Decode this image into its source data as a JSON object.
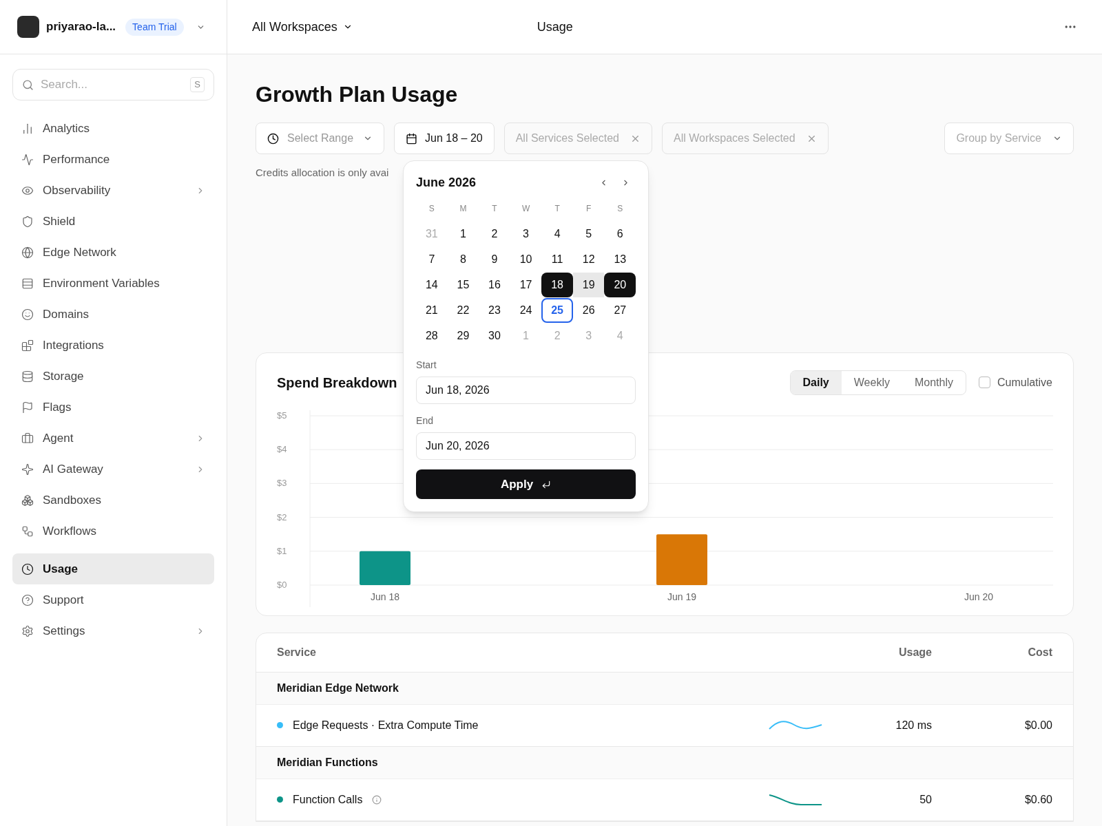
{
  "account": {
    "name": "priyarao-la...",
    "badge": "Team Trial"
  },
  "header": {
    "workspace": "All Workspaces",
    "title": "Usage"
  },
  "sidebar": {
    "search": {
      "placeholder": "Search...",
      "shortcut": "S"
    },
    "items": [
      {
        "label": "Analytics",
        "expandable": false,
        "selected": false
      },
      {
        "label": "Performance",
        "expandable": false,
        "selected": false
      },
      {
        "label": "Observability",
        "expandable": true,
        "selected": false
      },
      {
        "label": "Shield",
        "expandable": false,
        "selected": false
      },
      {
        "label": "Edge Network",
        "expandable": false,
        "selected": false
      },
      {
        "label": "Environment Variables",
        "expandable": false,
        "selected": false
      },
      {
        "label": "Domains",
        "expandable": false,
        "selected": false
      },
      {
        "label": "Integrations",
        "expandable": false,
        "selected": false
      },
      {
        "label": "Storage",
        "expandable": false,
        "selected": false
      },
      {
        "label": "Flags",
        "expandable": false,
        "selected": false
      },
      {
        "label": "Agent",
        "expandable": true,
        "selected": false
      },
      {
        "label": "AI Gateway",
        "expandable": true,
        "selected": false
      },
      {
        "label": "Sandboxes",
        "expandable": false,
        "selected": false
      },
      {
        "label": "Workflows",
        "expandable": false,
        "selected": false
      },
      {
        "label": "Usage",
        "expandable": false,
        "selected": true
      },
      {
        "label": "Support",
        "expandable": false,
        "selected": false
      },
      {
        "label": "Settings",
        "expandable": true,
        "selected": false
      }
    ]
  },
  "page": {
    "title": "Growth Plan Usage",
    "filters": {
      "range": "Select Range",
      "dates": "Jun 18 – 20",
      "services": "All Services Selected",
      "workspaces": "All Workspaces Selected",
      "group": "Group by Service"
    },
    "note": "Credits allocation is only avai"
  },
  "calendar": {
    "month": "June 2026",
    "weekdays": [
      "S",
      "M",
      "T",
      "W",
      "T",
      "F",
      "S"
    ],
    "days": [
      {
        "label": "31",
        "outside": true,
        "selected": false,
        "in_range": false,
        "today": false
      },
      {
        "label": "1",
        "outside": false,
        "selected": false,
        "in_range": false,
        "today": false
      },
      {
        "label": "2",
        "outside": false,
        "selected": false,
        "in_range": false,
        "today": false
      },
      {
        "label": "3",
        "outside": false,
        "selected": false,
        "in_range": false,
        "today": false
      },
      {
        "label": "4",
        "outside": false,
        "selected": false,
        "in_range": false,
        "today": false
      },
      {
        "label": "5",
        "outside": false,
        "selected": false,
        "in_range": false,
        "today": false
      },
      {
        "label": "6",
        "outside": false,
        "selected": false,
        "in_range": false,
        "today": false
      },
      {
        "label": "7",
        "outside": false,
        "selected": false,
        "in_range": false,
        "today": false
      },
      {
        "label": "8",
        "outside": false,
        "selected": false,
        "in_range": false,
        "today": false
      },
      {
        "label": "9",
        "outside": false,
        "selected": false,
        "in_range": false,
        "today": false
      },
      {
        "label": "10",
        "outside": false,
        "selected": false,
        "in_range": false,
        "today": false
      },
      {
        "label": "11",
        "outside": false,
        "selected": false,
        "in_range": false,
        "today": false
      },
      {
        "label": "12",
        "outside": false,
        "selected": false,
        "in_range": false,
        "today": false
      },
      {
        "label": "13",
        "outside": false,
        "selected": false,
        "in_range": false,
        "today": false
      },
      {
        "label": "14",
        "outside": false,
        "selected": false,
        "in_range": false,
        "today": false
      },
      {
        "label": "15",
        "outside": false,
        "selected": false,
        "in_range": false,
        "today": false
      },
      {
        "label": "16",
        "outside": false,
        "selected": false,
        "in_range": false,
        "today": false
      },
      {
        "label": "17",
        "outside": false,
        "selected": false,
        "in_range": false,
        "today": false
      },
      {
        "label": "18",
        "outside": false,
        "selected": true,
        "in_range": true,
        "today": false
      },
      {
        "label": "19",
        "outside": false,
        "selected": false,
        "in_range": true,
        "today": false
      },
      {
        "label": "20",
        "outside": false,
        "selected": true,
        "in_range": true,
        "today": false
      },
      {
        "label": "21",
        "outside": false,
        "selected": false,
        "in_range": false,
        "today": false
      },
      {
        "label": "22",
        "outside": false,
        "selected": false,
        "in_range": false,
        "today": false
      },
      {
        "label": "23",
        "outside": false,
        "selected": false,
        "in_range": false,
        "today": false
      },
      {
        "label": "24",
        "outside": false,
        "selected": false,
        "in_range": false,
        "today": false
      },
      {
        "label": "25",
        "outside": false,
        "selected": false,
        "in_range": false,
        "today": true
      },
      {
        "label": "26",
        "outside": false,
        "selected": false,
        "in_range": false,
        "today": false
      },
      {
        "label": "27",
        "outside": false,
        "selected": false,
        "in_range": false,
        "today": false
      },
      {
        "label": "28",
        "outside": false,
        "selected": false,
        "in_range": false,
        "today": false
      },
      {
        "label": "29",
        "outside": false,
        "selected": false,
        "in_range": false,
        "today": false
      },
      {
        "label": "30",
        "outside": false,
        "selected": false,
        "in_range": false,
        "today": false
      },
      {
        "label": "1",
        "outside": true,
        "selected": false,
        "in_range": false,
        "today": false
      },
      {
        "label": "2",
        "outside": true,
        "selected": false,
        "in_range": false,
        "today": false
      },
      {
        "label": "3",
        "outside": true,
        "selected": false,
        "in_range": false,
        "today": false
      },
      {
        "label": "4",
        "outside": true,
        "selected": false,
        "in_range": false,
        "today": false
      }
    ],
    "start": {
      "label": "Start",
      "value": "Jun 18, 2026"
    },
    "end": {
      "label": "End",
      "value": "Jun 20, 2026"
    },
    "apply": "Apply"
  },
  "spend": {
    "title": "Spend Breakdown",
    "periods": [
      {
        "label": "Daily",
        "selected": true
      },
      {
        "label": "Weekly",
        "selected": false
      },
      {
        "label": "Monthly",
        "selected": false
      }
    ],
    "cumulative": {
      "label": "Cumulative",
      "checked": false
    },
    "chart_data": {
      "type": "bar",
      "grid": true,
      "categories": [
        "Jun 18",
        "Jun 19",
        "Jun 20"
      ],
      "stacked": true,
      "ylim": [
        0,
        5
      ],
      "yticks": [
        {
          "value": 0,
          "label": "$0"
        },
        {
          "value": 1,
          "label": "$1"
        },
        {
          "value": 2,
          "label": "$2"
        },
        {
          "value": 3,
          "label": "$3"
        },
        {
          "value": 4,
          "label": "$4"
        },
        {
          "value": 5,
          "label": "$5"
        }
      ],
      "series": [
        {
          "color": "#0d9488",
          "values": [
            1.0,
            null,
            null
          ]
        },
        {
          "color": "#d97706",
          "values": [
            null,
            1.5,
            null
          ]
        }
      ]
    }
  },
  "table": {
    "columns": [
      "Service",
      "Usage",
      "Cost"
    ],
    "groups": [
      {
        "name": "Meridian Edge Network",
        "rows": [
          {
            "name": "Edge Requests · Extra Compute Time",
            "color": "#38bdf8",
            "info": false,
            "usage": "120 ms",
            "cost": "$0.00"
          }
        ]
      },
      {
        "name": "Meridian Functions",
        "rows": [
          {
            "name": "Function Calls",
            "color": "#0d9488",
            "info": true,
            "usage": "50",
            "cost": "$0.60"
          }
        ]
      }
    ]
  }
}
